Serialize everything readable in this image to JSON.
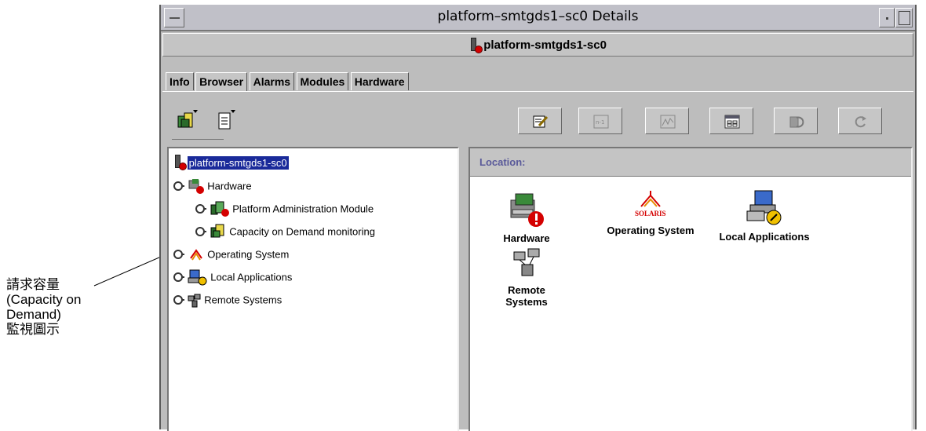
{
  "window": {
    "title": "platform–smtgds1–sc0 Details",
    "subtitle": "platform-smtgds1-sc0"
  },
  "tabs": [
    {
      "label": "Info"
    },
    {
      "label": "Browser"
    },
    {
      "label": "Alarms"
    },
    {
      "label": "Modules"
    },
    {
      "label": "Hardware"
    }
  ],
  "tree": {
    "root": "platform-smtgds1-sc0",
    "items": [
      {
        "label": "Hardware"
      },
      {
        "label": "Platform Administration Module"
      },
      {
        "label": "Capacity on Demand monitoring"
      },
      {
        "label": "Operating System"
      },
      {
        "label": "Local Applications"
      },
      {
        "label": "Remote Systems"
      }
    ]
  },
  "location": {
    "label": "Location:"
  },
  "icons": [
    {
      "label": "Hardware"
    },
    {
      "label": "Operating System"
    },
    {
      "label": "Local Applications"
    },
    {
      "label": "Remote Systems"
    }
  ],
  "solaris_logo_text": "SOLARIS",
  "toolbar": {
    "buttons": [
      "edit-icon",
      "n1-icon",
      "graph-icon",
      "table-icon",
      "refresh-icon",
      "rotate-icon"
    ],
    "n1_text": "n-1"
  },
  "callout": {
    "lines": [
      "請求容量",
      "(Capacity on",
      "Demand)",
      "監視圖示"
    ]
  },
  "colors": {
    "selection": "#1a2a9a",
    "alarm": "#d40000",
    "location_text": "#5a5a9a"
  }
}
